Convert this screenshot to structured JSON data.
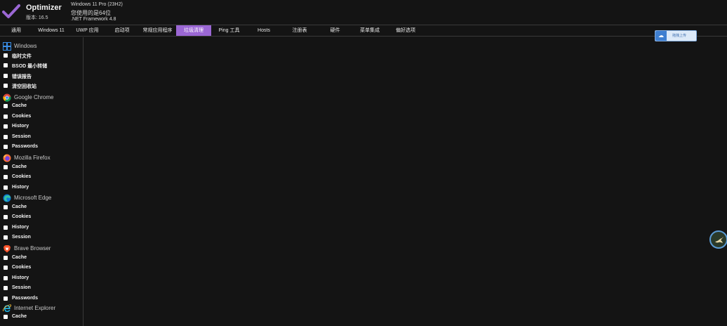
{
  "app": {
    "title": "Optimizer",
    "version": "版本: 16.5"
  },
  "system_info": [
    "Windows 11 Pro (23H2)",
    "您使用的是64位",
    ".NET Framework 4.8"
  ],
  "tabs": [
    "通用",
    "Windows 11",
    "UWP 应用",
    "启动项",
    "常规应用程序",
    "垃圾清理",
    "Ping 工具",
    "Hosts",
    "注册表",
    "硬件",
    "菜单集成",
    "偏好选项"
  ],
  "active_tab": "垃圾清理",
  "sidebar": [
    {
      "name": "Windows",
      "icon": "windows-icon",
      "items": [
        "临时文件",
        "BSOD 最小转储",
        "错误报告",
        "清空回收站"
      ]
    },
    {
      "name": "Google Chrome",
      "icon": "chrome-icon",
      "items": [
        "Cache",
        "Cookies",
        "History",
        "Session",
        "Passwords"
      ]
    },
    {
      "name": "Mozilla Firefox",
      "icon": "firefox-icon",
      "items": [
        "Cache",
        "Cookies",
        "History"
      ]
    },
    {
      "name": "Microsoft Edge",
      "icon": "edge-icon",
      "items": [
        "Cache",
        "Cookies",
        "History",
        "Session"
      ]
    },
    {
      "name": "Brave Browser",
      "icon": "brave-icon",
      "items": [
        "Cache",
        "Cookies",
        "History",
        "Session",
        "Passwords"
      ]
    },
    {
      "name": "Internet Explorer",
      "icon": "ie-icon",
      "items": [
        "Cache"
      ]
    }
  ],
  "upload_button": {
    "label": "拖拽上传",
    "icon": "cloud-upload-icon"
  },
  "float_button": {
    "icon": "hummingbird-icon"
  },
  "colors": {
    "background": "#141414",
    "accent": "#9b67d4",
    "divider": "#3a3a3a"
  }
}
